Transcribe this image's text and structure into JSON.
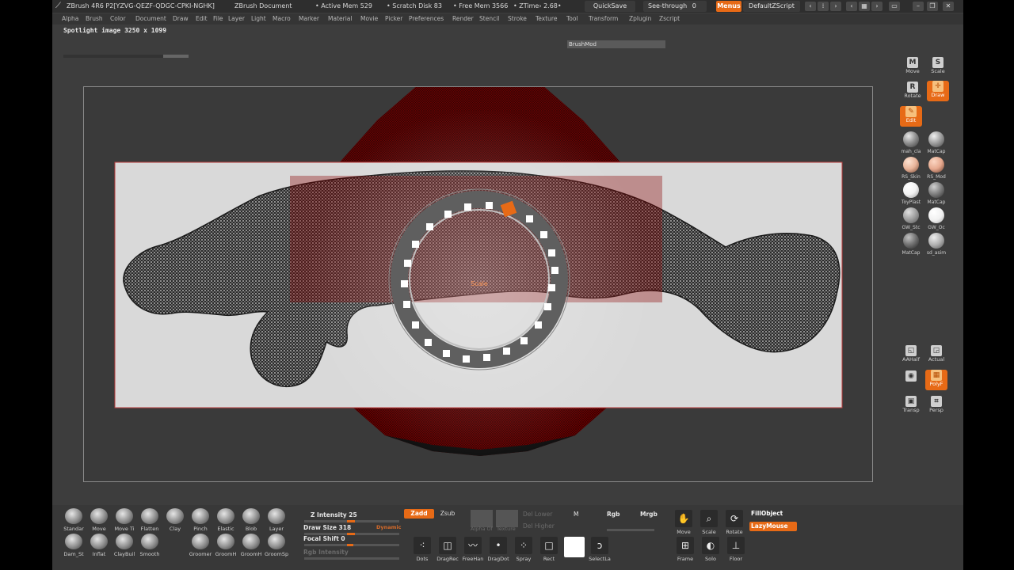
{
  "titlebar": {
    "app": "ZBrush 4R6 P2[YZVG-QEZF-QDGC-CPKI-NGHK]",
    "document": "ZBrush Document",
    "active_mem": "• Active Mem 529",
    "scratch": "• Scratch Disk 83",
    "free_mem": "• Free Mem 3566",
    "ztime": "• ZTime› 2.68•",
    "quicksave": "QuickSave",
    "see_through_label": "See-through",
    "see_through_value": "0",
    "menus": "Menus",
    "zscript": "DefaultZScript"
  },
  "menus": [
    "Alpha",
    "Brush",
    "Color",
    "Document",
    "Draw",
    "Edit",
    "File",
    "Layer",
    "Light",
    "Macro",
    "Marker",
    "Material",
    "Movie",
    "Picker",
    "Preferences",
    "Render",
    "Stencil",
    "Stroke",
    "Texture",
    "Tool",
    "Transform",
    "Zplugin",
    "Zscript"
  ],
  "status": {
    "spotlight": "Spotlight image 3250 x 1099",
    "brushmod": "BrushMod"
  },
  "canvas": {
    "radial_center_label": "Scale",
    "colors": {
      "model": "#7a0000",
      "spotlight_bg": "#d9d9d9",
      "ring": "#5f5f5f",
      "selected_icon": "#e76a16"
    }
  },
  "right_shelf": {
    "move": "Move",
    "scale": "Scale",
    "rotate": "Rotate",
    "draw": "Draw",
    "edit": "Edit",
    "materials": [
      {
        "label": "mah_cla",
        "color": "#8a8a8a"
      },
      {
        "label": "MatCap",
        "color": "#9a9a9a"
      },
      {
        "label": "RS_Skin",
        "color": "#e8b49a"
      },
      {
        "label": "RS_Mod",
        "color": "#e6a98f"
      },
      {
        "label": "ToyPlast",
        "color": "#f2f2f2"
      },
      {
        "label": "MatCap",
        "color": "#7d7d7d"
      },
      {
        "label": "GW_Stc",
        "color": "#9e9e9e"
      },
      {
        "label": "GW_Oc",
        "color": "#f0f0f0"
      },
      {
        "label": "MatCap",
        "color": "#6f6f6f"
      },
      {
        "label": "sd_asim",
        "color": "#b0b0b0"
      }
    ],
    "aahalf": "AAHalf",
    "actual": "Actual",
    "polyf": "PolyF",
    "transp": "Transp",
    "persp": "Persp"
  },
  "bottom": {
    "brushes_row1": [
      "Standar",
      "Move",
      "Move Ti",
      "Flatten",
      "Clay",
      "Pinch",
      "Elastic",
      "Blob",
      "Layer"
    ],
    "brushes_row2": [
      "Dam_St",
      "Inflat",
      "ClayBuil",
      "Smooth",
      "Groomer",
      "GroomH",
      "GroomH",
      "GroomSp"
    ],
    "z_intensity": {
      "label": "Z Intensity 25",
      "value": 25
    },
    "dynamic": "Dynamic",
    "draw_size": {
      "label": "Draw Size 318",
      "value": 318
    },
    "focal_shift": {
      "label": "Focal Shift 0",
      "value": 0
    },
    "rgb_intensity": "Rgb Intensity",
    "zadd": "Zadd",
    "zsub": "Zsub",
    "alpha_label": "Alpha Of",
    "texture_label": "Texture",
    "del_lower": "Del Lower",
    "del_higher": "Del Higher",
    "m": "M",
    "rgb": "Rgb",
    "mrgb": "Mrgb",
    "strokes": [
      "Dots",
      "DragRec",
      "FreeHan",
      "DragDot",
      "Spray",
      "Rect",
      "",
      "SelectLa"
    ],
    "nav": [
      "Move",
      "Scale",
      "Rotate"
    ],
    "fill_object": "FillObject",
    "lazymouse": "LazyMouse",
    "frame": "Frame",
    "solo": "Solo",
    "floor": "Floor"
  }
}
